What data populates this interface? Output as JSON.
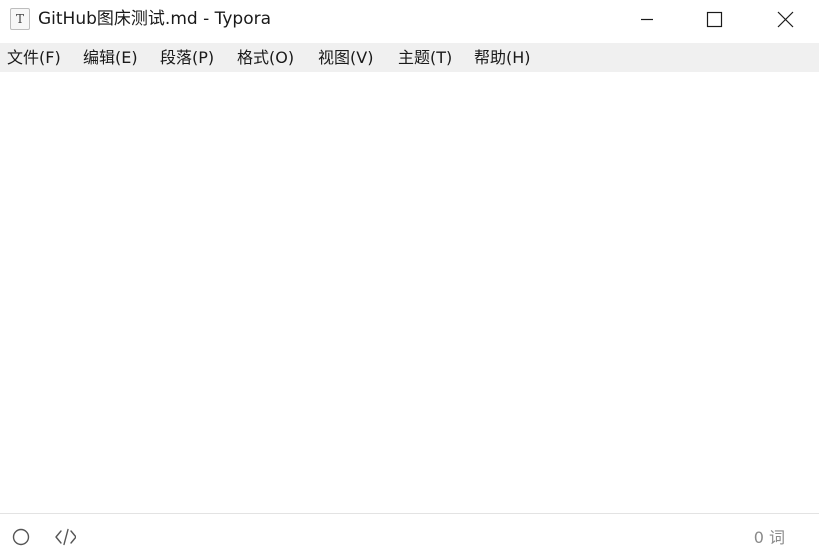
{
  "window": {
    "title": "GitHub图床测试.md - Typora",
    "app_icon_glyph": "T"
  },
  "menu": {
    "items": [
      {
        "label": "文件(F)"
      },
      {
        "label": "编辑(E)"
      },
      {
        "label": "段落(P)"
      },
      {
        "label": "格式(O)"
      },
      {
        "label": "视图(V)"
      },
      {
        "label": "主题(T)"
      },
      {
        "label": "帮助(H)"
      }
    ]
  },
  "statusbar": {
    "word_count": "0 词",
    "icons": [
      "sidebar-toggle-circle-icon",
      "source-code-mode-icon"
    ]
  },
  "colors": {
    "menubar_bg": "#f0f0f0",
    "statusbar_text": "#8a8a8a"
  }
}
